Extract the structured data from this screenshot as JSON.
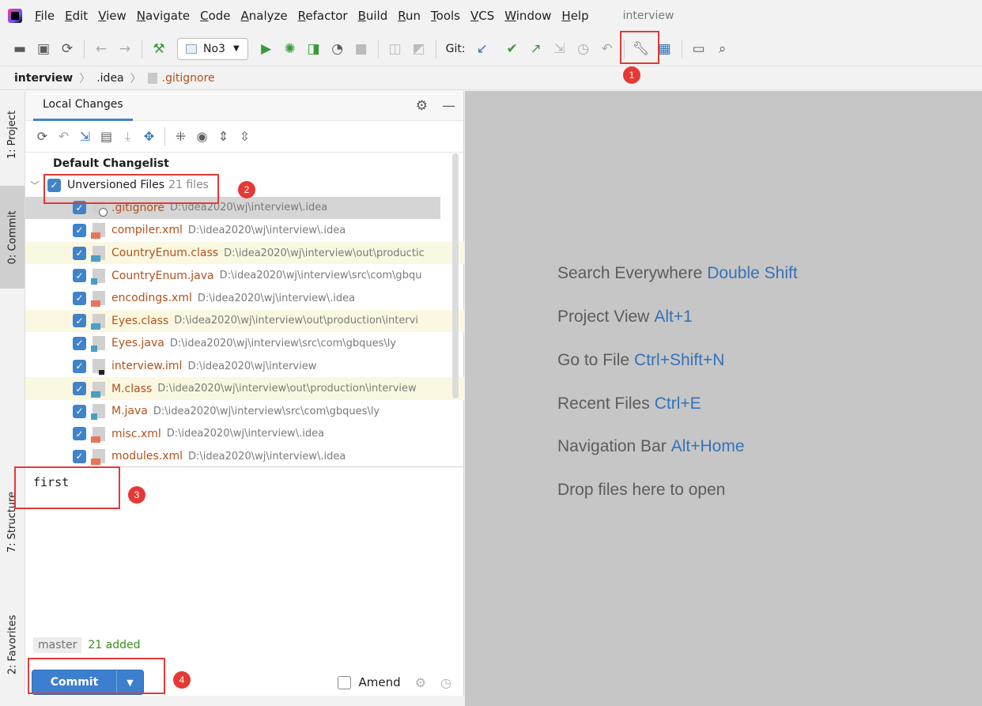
{
  "menu": {
    "items": [
      "File",
      "Edit",
      "View",
      "Navigate",
      "Code",
      "Analyze",
      "Refactor",
      "Build",
      "Run",
      "Tools",
      "VCS",
      "Window",
      "Help"
    ],
    "project_title": "interview"
  },
  "toolbar": {
    "run_config": "No3",
    "git_label": "Git:"
  },
  "breadcrumb": {
    "project": "interview",
    "folder": ".idea",
    "file": ".gitignore"
  },
  "left_strip": {
    "project_tab": "1: Project",
    "commit_tab": "0: Commit",
    "structure_tab": "7: Structure",
    "favorites_tab": "2: Favorites"
  },
  "panel": {
    "tab_label": "Local Changes",
    "changelist": "Default Changelist",
    "group_label": "Unversioned Files",
    "group_count": "21 files",
    "files": [
      {
        "name": ".gitignore",
        "path": "D:\\idea2020\\wj\\interview\\.idea",
        "icon": "gitignore-file-icon"
      },
      {
        "name": "compiler.xml",
        "path": "D:\\idea2020\\wj\\interview\\.idea",
        "icon": "xml-file-icon"
      },
      {
        "name": "CountryEnum.class",
        "path": "D:\\idea2020\\wj\\interview\\out\\productic",
        "icon": "class-file-icon"
      },
      {
        "name": "CountryEnum.java",
        "path": "D:\\idea2020\\wj\\interview\\src\\com\\gbqu",
        "icon": "java-file-icon"
      },
      {
        "name": "encodings.xml",
        "path": "D:\\idea2020\\wj\\interview\\.idea",
        "icon": "xml-file-icon"
      },
      {
        "name": "Eyes.class",
        "path": "D:\\idea2020\\wj\\interview\\out\\production\\intervi",
        "icon": "class-file-icon"
      },
      {
        "name": "Eyes.java",
        "path": "D:\\idea2020\\wj\\interview\\src\\com\\gbques\\ly",
        "icon": "java-file-icon"
      },
      {
        "name": "interview.iml",
        "path": "D:\\idea2020\\wj\\interview",
        "icon": "iml-file-icon"
      },
      {
        "name": "M.class",
        "path": "D:\\idea2020\\wj\\interview\\out\\production\\interview",
        "icon": "class-file-icon"
      },
      {
        "name": "M.java",
        "path": "D:\\idea2020\\wj\\interview\\src\\com\\gbques\\ly",
        "icon": "java-file-icon"
      },
      {
        "name": "misc.xml",
        "path": "D:\\idea2020\\wj\\interview\\.idea",
        "icon": "xml-file-icon"
      },
      {
        "name": "modules.xml",
        "path": "D:\\idea2020\\wj\\interview\\.idea",
        "icon": "xml-file-icon"
      }
    ],
    "commit_message": "first",
    "branch": "master",
    "added": "21 added",
    "commit_button": "Commit",
    "amend_label": "Amend"
  },
  "editor_hints": [
    {
      "label": "Search Everywhere",
      "key": "Double Shift"
    },
    {
      "label": "Project View",
      "key": "Alt+1"
    },
    {
      "label": "Go to File",
      "key": "Ctrl+Shift+N"
    },
    {
      "label": "Recent Files",
      "key": "Ctrl+E"
    },
    {
      "label": "Navigation Bar",
      "key": "Alt+Home"
    },
    {
      "label": "Drop files here to open",
      "key": ""
    }
  ],
  "annotations": [
    "1",
    "2",
    "3",
    "4"
  ],
  "colors": {
    "accent": "#4083c9",
    "annotation": "#e53935",
    "unversioned_file": "#b3501a",
    "added": "#3c8c1e"
  }
}
